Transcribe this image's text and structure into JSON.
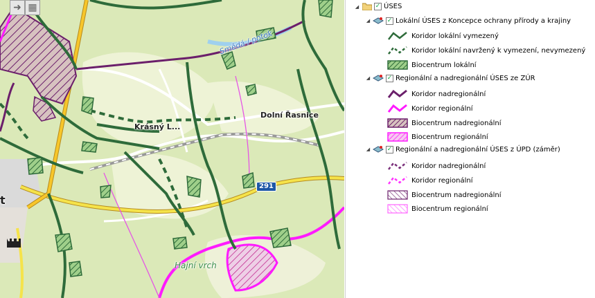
{
  "map": {
    "labels": {
      "town_krasny": "Krásný L...",
      "town_dolni": "Dolní Řasnice",
      "water_name": "Smědá / potok",
      "hill": "Hajní vrch",
      "road_number": "291",
      "left_letter": "t"
    },
    "toolbar": {
      "pan_icon": "arrow-right-icon",
      "extent_icon": "zoom-extent-icon"
    }
  },
  "legend": {
    "root": {
      "label": "ÚSES",
      "checked": true
    },
    "groups": [
      {
        "label": "Lokální ÚSES z Koncepce ochrany přírody a krajiny",
        "checked": true,
        "items": [
          {
            "label": "Koridor lokální vymezený",
            "symbol": "line-solid",
            "color": "#2e6b3a"
          },
          {
            "label": "Koridor lokální navržený k vymezení, nevymezený",
            "symbol": "line-dashed",
            "color": "#2e6b3a"
          },
          {
            "label": "Biocentrum lokální",
            "symbol": "hatch",
            "color": "#2e6b3a"
          }
        ]
      },
      {
        "label": "Regionální a nadregionální ÚSES ze ZÚR",
        "checked": true,
        "items": [
          {
            "label": "Koridor nadregionální",
            "symbol": "line-solid",
            "color": "#6b1f6b"
          },
          {
            "label": "Koridor regionální",
            "symbol": "line-solid",
            "color": "#ff1aff"
          },
          {
            "label": "Biocentrum nadregionální",
            "symbol": "hatch",
            "color": "#6b1f6b"
          },
          {
            "label": "Biocentrum regionální",
            "symbol": "hatch",
            "color": "#ff1aff"
          }
        ]
      },
      {
        "label": "Regionální a nadregionální ÚSES z ÚPD (záměr)",
        "checked": true,
        "items": [
          {
            "label": "Koridor nadregionální",
            "symbol": "line-dashed",
            "color": "#7a2f7a"
          },
          {
            "label": "Koridor regionální",
            "symbol": "line-dashed",
            "color": "#ff33ff"
          },
          {
            "label": "Biocentrum nadregionální",
            "symbol": "hatch-light",
            "color": "#6b1f6b"
          },
          {
            "label": "Biocentrum regionální",
            "symbol": "hatch-light",
            "color": "#ff66ff"
          }
        ]
      }
    ]
  }
}
